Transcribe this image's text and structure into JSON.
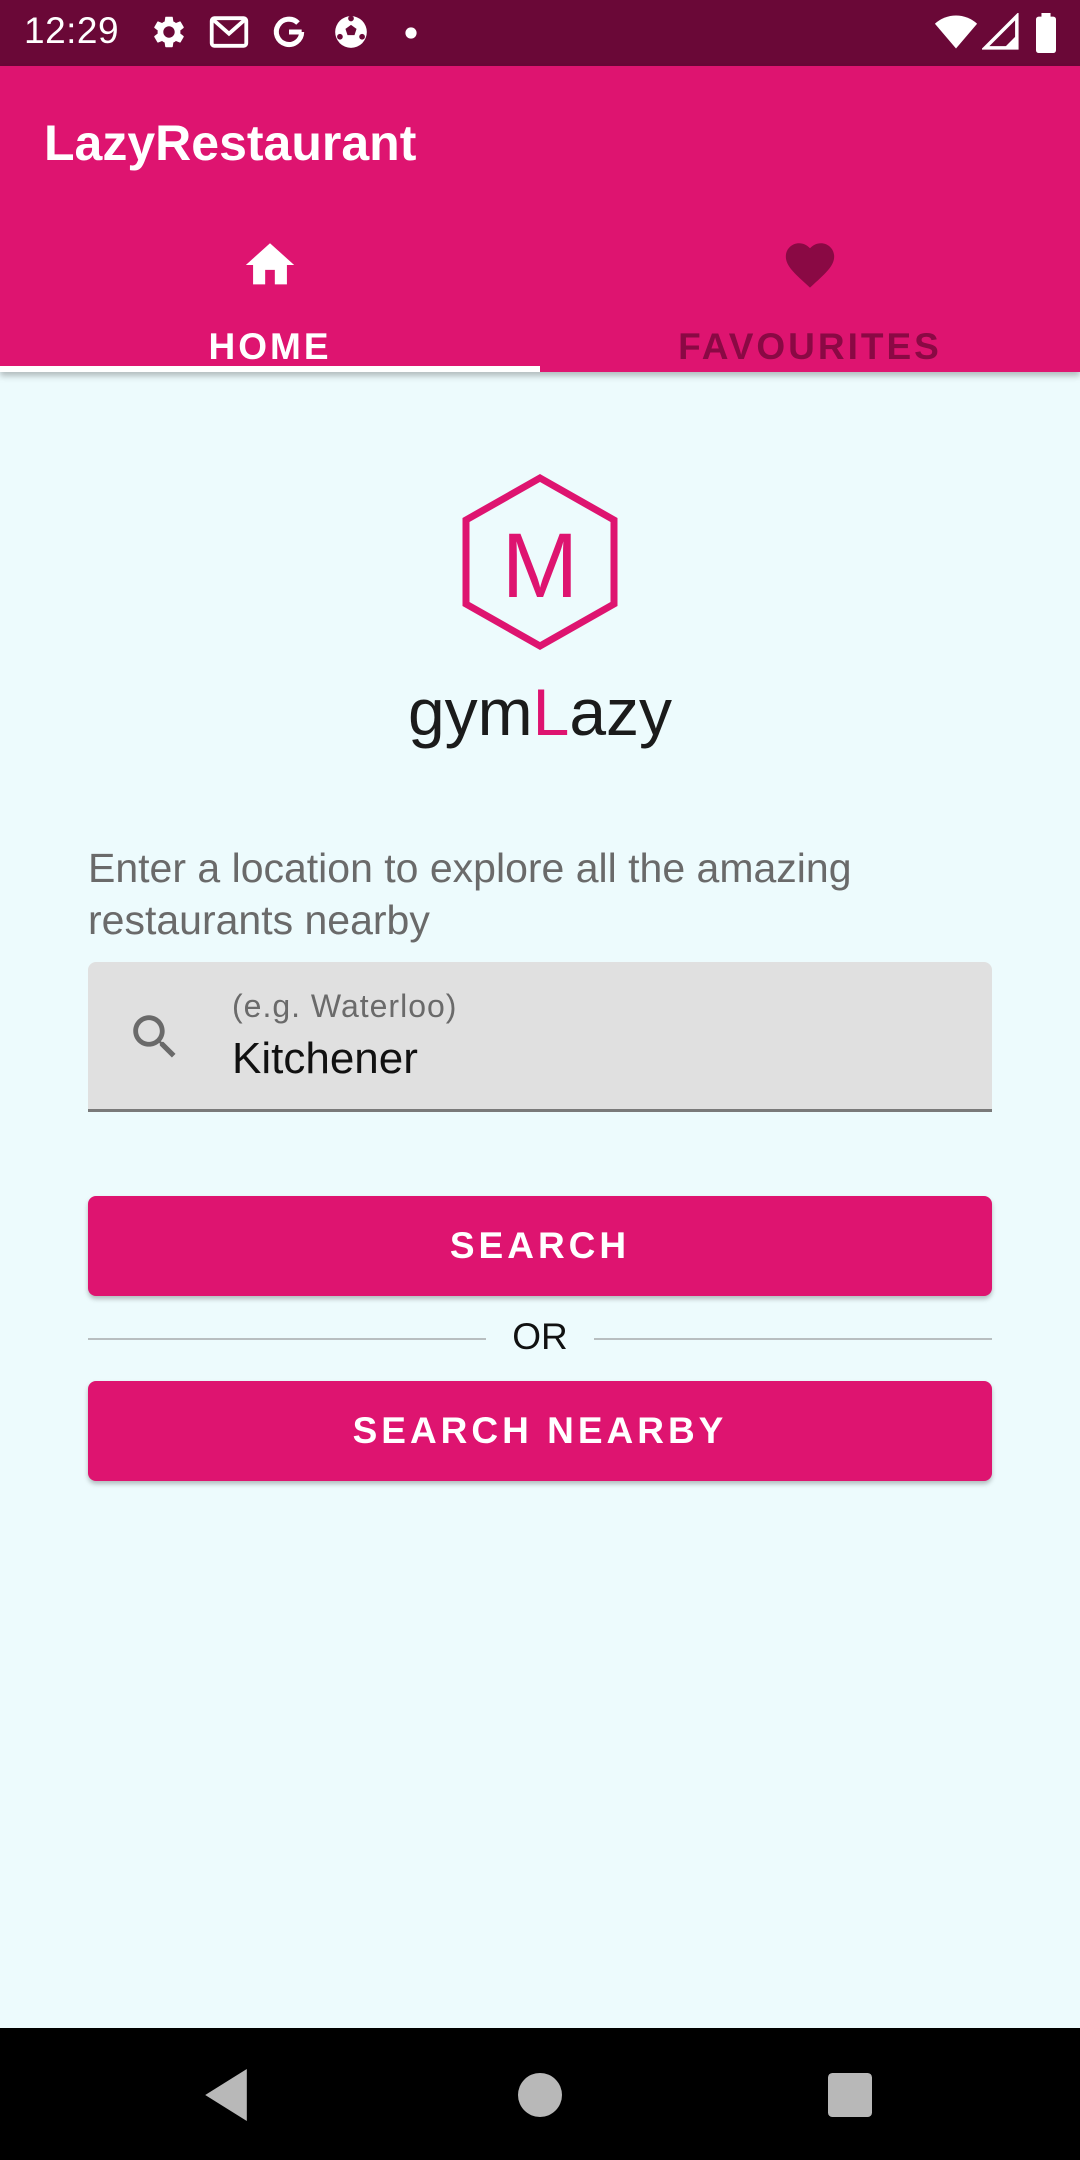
{
  "status_bar": {
    "time": "12:29",
    "icons_left": [
      "settings-icon",
      "gmail-icon",
      "google-icon",
      "soccer-ball-icon",
      "notification-dot-icon"
    ],
    "icons_right": [
      "wifi-icon",
      "signal-icon",
      "battery-icon"
    ]
  },
  "app_bar": {
    "title": "LazyRestaurant"
  },
  "tabs": [
    {
      "label": "HOME",
      "icon": "home-icon",
      "selected": true
    },
    {
      "label": "FAVOURITES",
      "icon": "heart-icon",
      "selected": false
    }
  ],
  "logo": {
    "letter": "M",
    "text_prefix": "gym",
    "text_highlight": "L",
    "text_suffix": "azy"
  },
  "main": {
    "prompt": "Enter a location to explore all the amazing restaurants nearby",
    "search_field": {
      "placeholder": "(e.g. Waterloo)",
      "value": "Kitchener"
    },
    "search_button": "SEARCH",
    "or_label": "OR",
    "search_nearby_button": "SEARCH NEARBY"
  },
  "nav_bar": {
    "buttons": [
      "back-icon",
      "home-circle-icon",
      "recents-icon"
    ]
  },
  "colors": {
    "primary": "#DE1470",
    "status_bar": "#6A0837",
    "background": "#EDFBFD",
    "field_background": "#E0E0E0"
  }
}
